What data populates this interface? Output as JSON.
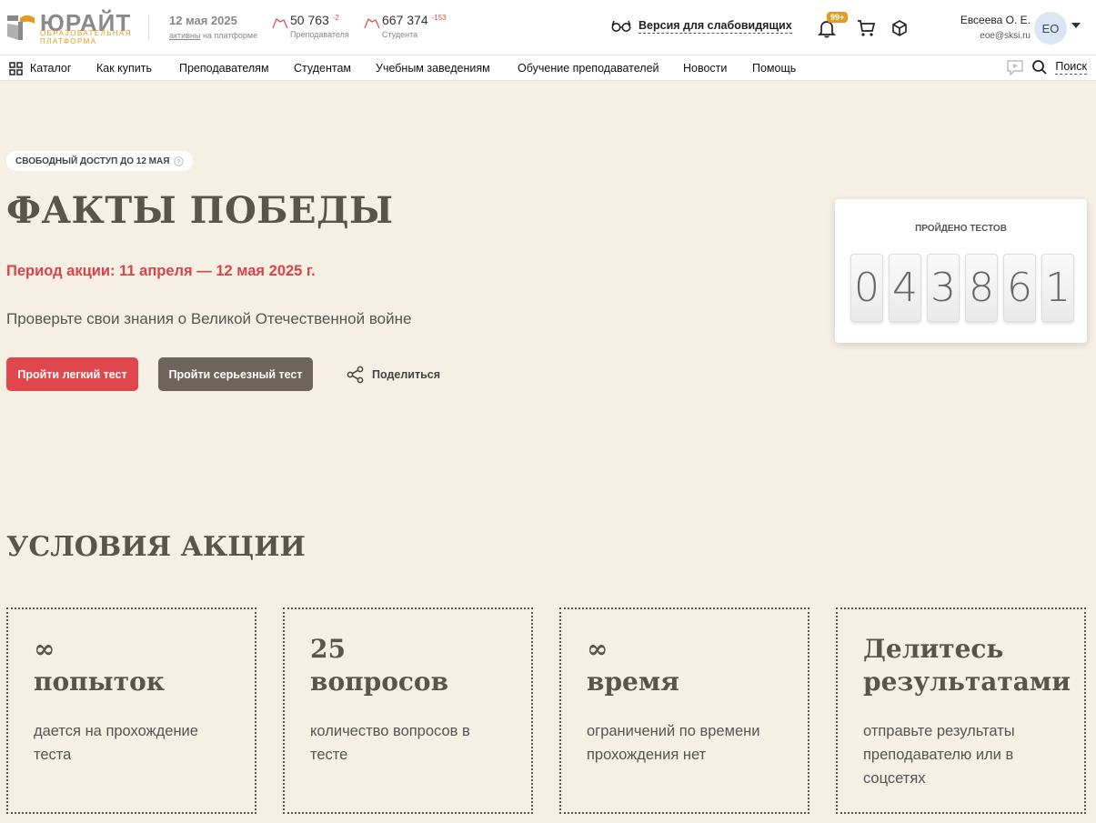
{
  "header": {
    "logo_title": "ЮРАЙТ",
    "logo_subtitle": "ОБРАЗОВАТЕЛЬНАЯ ПЛАТФОРМА",
    "date": "12 мая 2025",
    "active_link": "активны",
    "active_suffix": "на платформе",
    "stats": [
      {
        "value": "50 763",
        "delta": "-2",
        "label": "Преподавателя"
      },
      {
        "value": "667 374",
        "delta": "-153",
        "label": "Студента"
      }
    ],
    "vision_label": "Версия для слабовидящих",
    "notifications_badge": "99+",
    "user_name": "Евсеева О. Е.",
    "user_email": "eoe@sksi.ru",
    "avatar_initials": "ЕО"
  },
  "nav": {
    "items": [
      "Каталог",
      "Как купить",
      "Преподавателям",
      "Студентам",
      "Учебным заведениям",
      "Обучение преподавателей",
      "Новости",
      "Помощь"
    ],
    "search_label": "Поиск"
  },
  "hero": {
    "access_pill": "СВОБОДНЫЙ ДОСТУП ДО 12 МАЯ",
    "title": "ФАКТЫ ПОБЕДЫ",
    "period": "Период акции: 11 апреля — 12 мая 2025 г.",
    "description": "Проверьте свои знания о Великой Отечественной войне",
    "btn_easy": "Пройти легкий тест",
    "btn_hard": "Пройти серьезный тест",
    "share_label": "Поделиться",
    "counter_label": "ПРОЙДЕНО ТЕСТОВ",
    "counter_digits": [
      "0",
      "4",
      "3",
      "8",
      "6",
      "1"
    ]
  },
  "conditions": {
    "title": "УСЛОВИЯ АКЦИИ",
    "cards": [
      {
        "value": "∞",
        "unit": "попыток",
        "text": "дается на прохождение теста"
      },
      {
        "value": "25",
        "unit": "вопросов",
        "text": "количество вопросов в тесте"
      },
      {
        "value": "∞",
        "unit": "время",
        "text": "ограничений по времени прохождения нет"
      },
      {
        "value": "Делитесь",
        "unit": "результатами",
        "text": "отправьте результаты преподавателю или в соцсетях"
      }
    ]
  },
  "colors": {
    "accent_red": "#e0474c",
    "brand_orange": "#e29a1f",
    "dark_button": "#6d645a",
    "page_bg": "#f5efe4"
  }
}
